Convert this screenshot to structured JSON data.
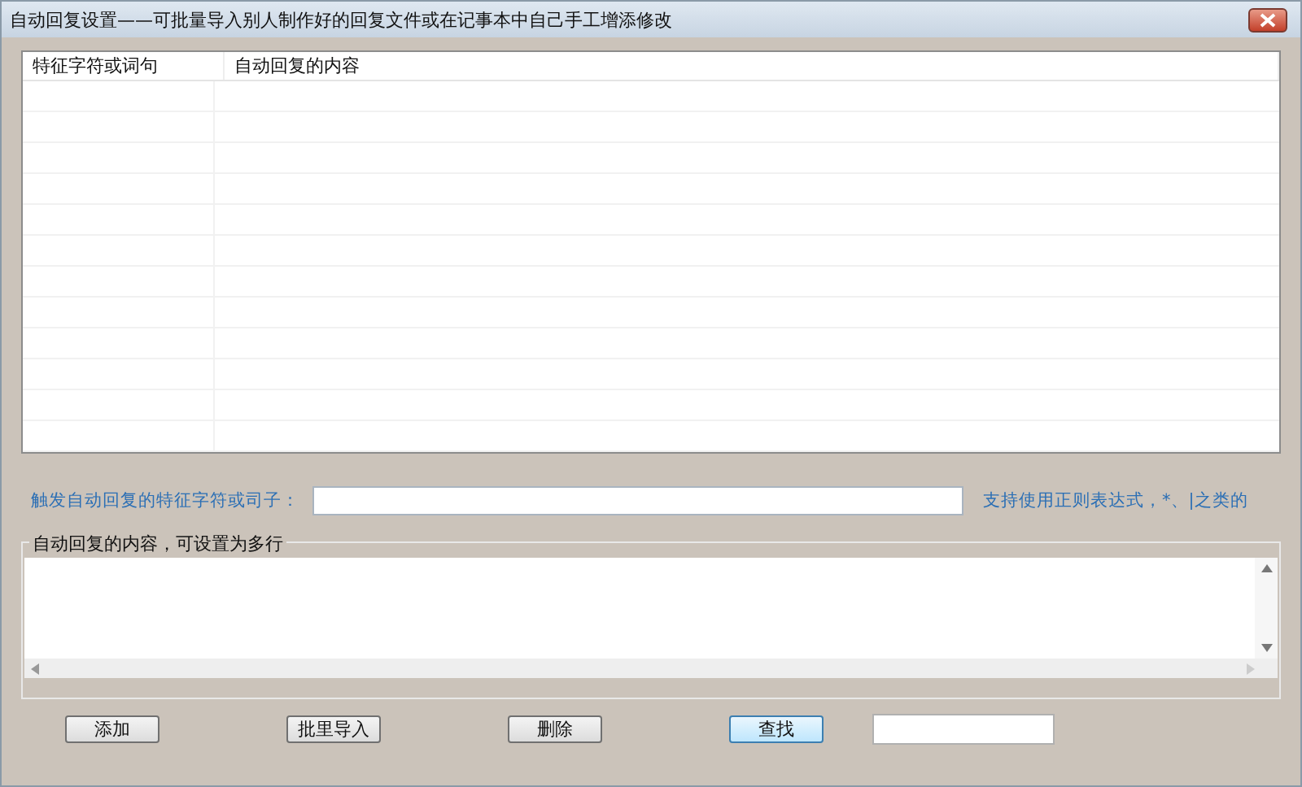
{
  "window": {
    "title": "自动回复设置——可批量导入别人制作好的回复文件或在记事本中自己手工增添修改"
  },
  "table": {
    "columns": [
      "特征字符或词句",
      "自动回复的内容"
    ]
  },
  "trigger": {
    "label": "触发自动回复的特征字符或司子：",
    "hint": "支持使用正则表达式，*、|之类的"
  },
  "reply_group": {
    "title": "自动回复的内容，可设置为多行"
  },
  "buttons": [
    {
      "label": "添加",
      "focused": false
    },
    {
      "label": "批里导入",
      "focused": false
    },
    {
      "label": "删除",
      "focused": false
    },
    {
      "label": "查找",
      "focused": true
    }
  ]
}
